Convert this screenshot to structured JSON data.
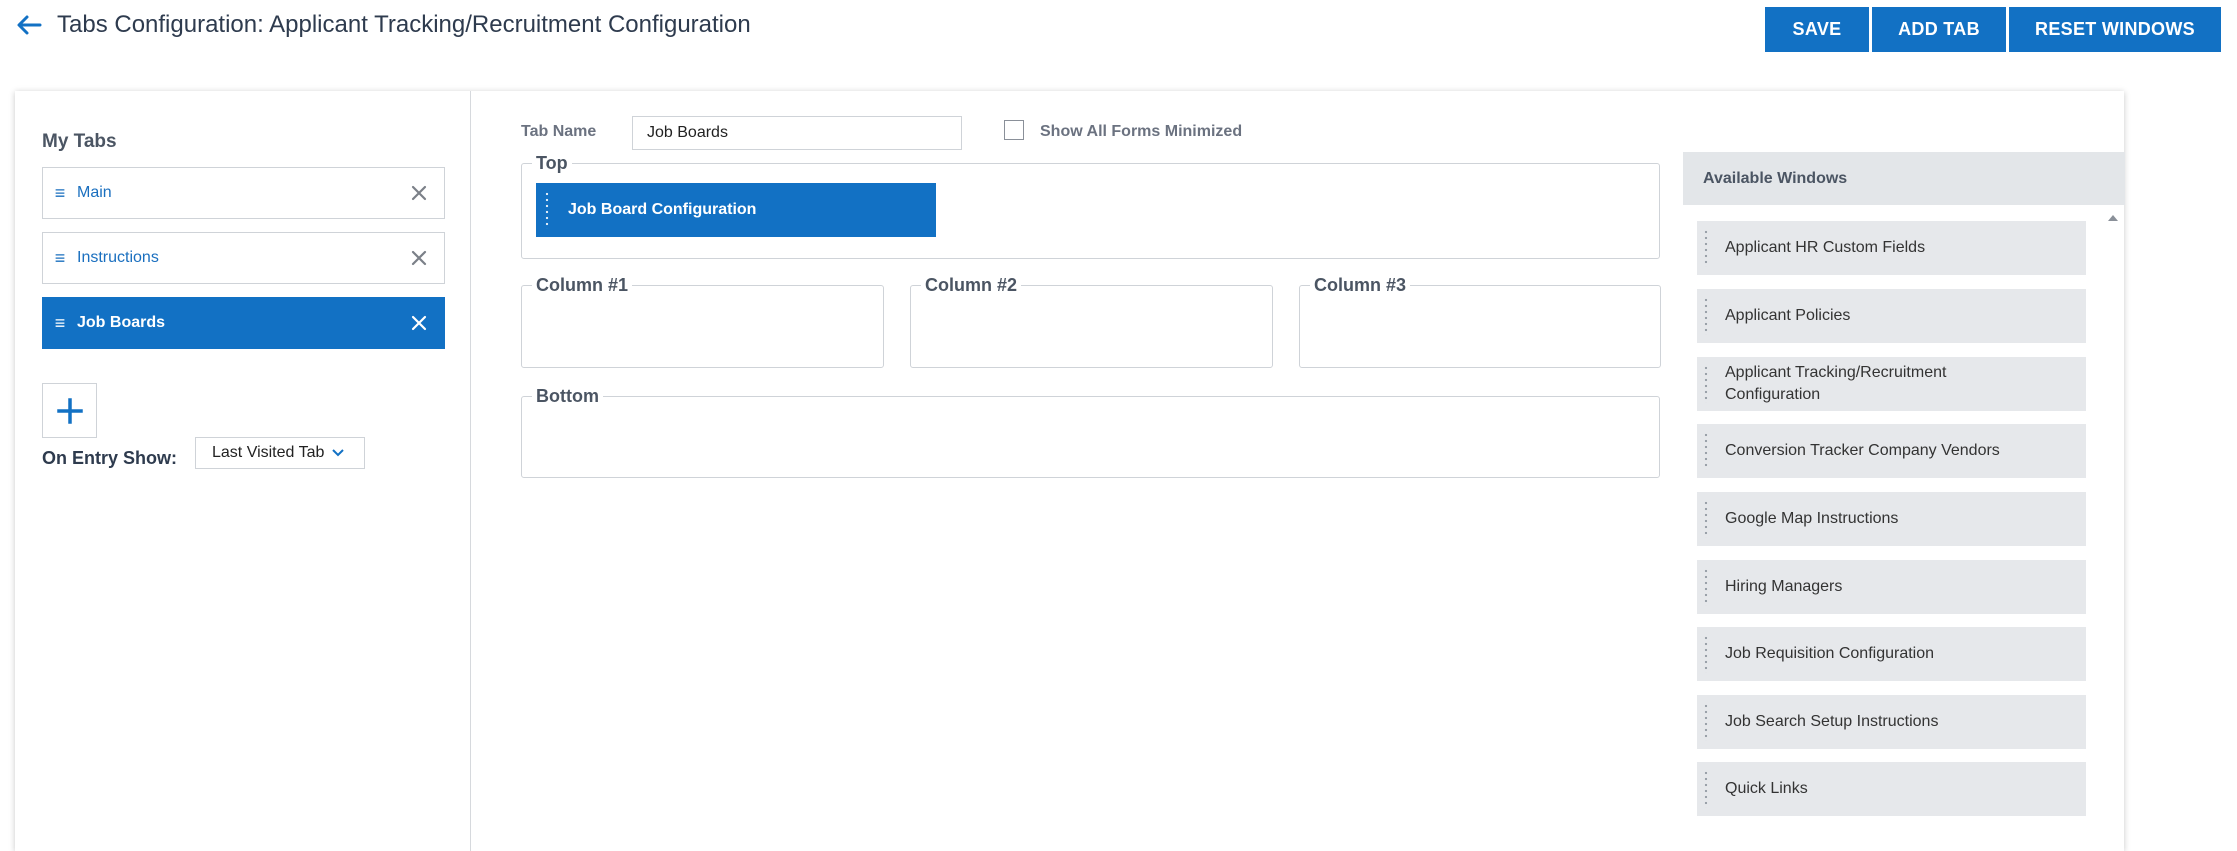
{
  "header": {
    "title": "Tabs Configuration: Applicant Tracking/Recruitment Configuration",
    "buttons": {
      "save": "SAVE",
      "add_tab": "ADD TAB",
      "reset_windows": "RESET WINDOWS"
    }
  },
  "my_tabs": {
    "heading": "My Tabs",
    "items": [
      {
        "label": "Main",
        "active": false
      },
      {
        "label": "Instructions",
        "active": false
      },
      {
        "label": "Job Boards",
        "active": true
      }
    ],
    "on_entry_label": "On Entry Show:",
    "on_entry_value": "Last Visited Tab"
  },
  "editor": {
    "tab_name_label": "Tab Name",
    "tab_name_value": "Job Boards",
    "show_minimized_label": "Show All Forms Minimized",
    "zones": {
      "top": "Top",
      "column1": "Column #1",
      "column2": "Column #2",
      "column3": "Column #3",
      "bottom": "Bottom"
    },
    "top_windows": [
      "Job Board Configuration"
    ]
  },
  "available": {
    "heading": "Available Windows",
    "items": [
      "Applicant HR Custom Fields",
      "Applicant Policies",
      "Applicant Tracking/Recruitment Configuration",
      "Conversion Tracker Company Vendors",
      "Google Map Instructions",
      "Hiring Managers",
      "Job Requisition Configuration",
      "Job Search Setup Instructions",
      "Quick Links"
    ]
  },
  "colors": {
    "accent": "#1271c4",
    "panel": "#e6e8eb"
  }
}
